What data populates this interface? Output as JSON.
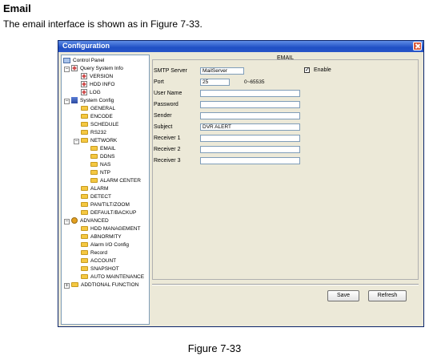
{
  "doc": {
    "heading": "Email",
    "intro": "The email interface is shown as in Figure 7-33.",
    "caption": "Figure 7-33"
  },
  "window": {
    "title": "Configuration"
  },
  "tree": {
    "items": [
      {
        "label": "Control Panel",
        "icon": "panel-icon"
      },
      {
        "label": "Query System Info",
        "icon": "doc-icon"
      },
      {
        "label": "VERSION",
        "icon": "doc-icon"
      },
      {
        "label": "HDD INFO",
        "icon": "doc-icon"
      },
      {
        "label": "LOG",
        "icon": "doc-icon"
      },
      {
        "label": "System Config",
        "icon": "system-icon"
      },
      {
        "label": "GENERAL",
        "icon": "folder-icon"
      },
      {
        "label": "ENCODE",
        "icon": "folder-icon"
      },
      {
        "label": "SCHEDULE",
        "icon": "folder-icon"
      },
      {
        "label": "RS232",
        "icon": "folder-icon"
      },
      {
        "label": "NETWORK",
        "icon": "folder-icon"
      },
      {
        "label": "EMAIL",
        "icon": "folder-icon"
      },
      {
        "label": "DDNS",
        "icon": "folder-icon"
      },
      {
        "label": "NAS",
        "icon": "folder-icon"
      },
      {
        "label": "NTP",
        "icon": "folder-icon"
      },
      {
        "label": "ALARM CENTER",
        "icon": "folder-icon"
      },
      {
        "label": "ALARM",
        "icon": "folder-icon"
      },
      {
        "label": "DETECT",
        "icon": "folder-icon"
      },
      {
        "label": "PAN/TILT/ZOOM",
        "icon": "folder-icon"
      },
      {
        "label": "DEFAULT/BACKUP",
        "icon": "folder-icon"
      },
      {
        "label": "ADVANCED",
        "icon": "gear-icon"
      },
      {
        "label": "HDD MANAGEMENT",
        "icon": "folder-icon"
      },
      {
        "label": "ABNORMITY",
        "icon": "folder-icon"
      },
      {
        "label": "Alarm I/O Config",
        "icon": "folder-icon"
      },
      {
        "label": "Record",
        "icon": "folder-icon"
      },
      {
        "label": "ACCOUNT",
        "icon": "folder-icon"
      },
      {
        "label": "SNAPSHOT",
        "icon": "folder-icon"
      },
      {
        "label": "AUTO MAINTENANCE",
        "icon": "folder-icon"
      },
      {
        "label": "ADDTIONAL FUNCTION",
        "icon": "folder-icon"
      }
    ]
  },
  "email_form": {
    "group_title": "EMAIL",
    "smtp_server_label": "SMTP Server",
    "smtp_server_value": "MailServer",
    "enable_label": "Enable",
    "enable_checked": "✓",
    "port_label": "Port",
    "port_value": "25",
    "port_range": "0~65535",
    "user_name_label": "User Name",
    "user_name_value": "",
    "password_label": "Password",
    "password_value": "",
    "sender_label": "Sender",
    "sender_value": "",
    "subject_label": "Subject",
    "subject_value": "DVR ALERT",
    "receiver1_label": "Receiver 1",
    "receiver1_value": "",
    "receiver2_label": "Receiver 2",
    "receiver2_value": "",
    "receiver3_label": "Receiver 3",
    "receiver3_value": ""
  },
  "buttons": {
    "save": "Save",
    "refresh": "Refresh"
  }
}
